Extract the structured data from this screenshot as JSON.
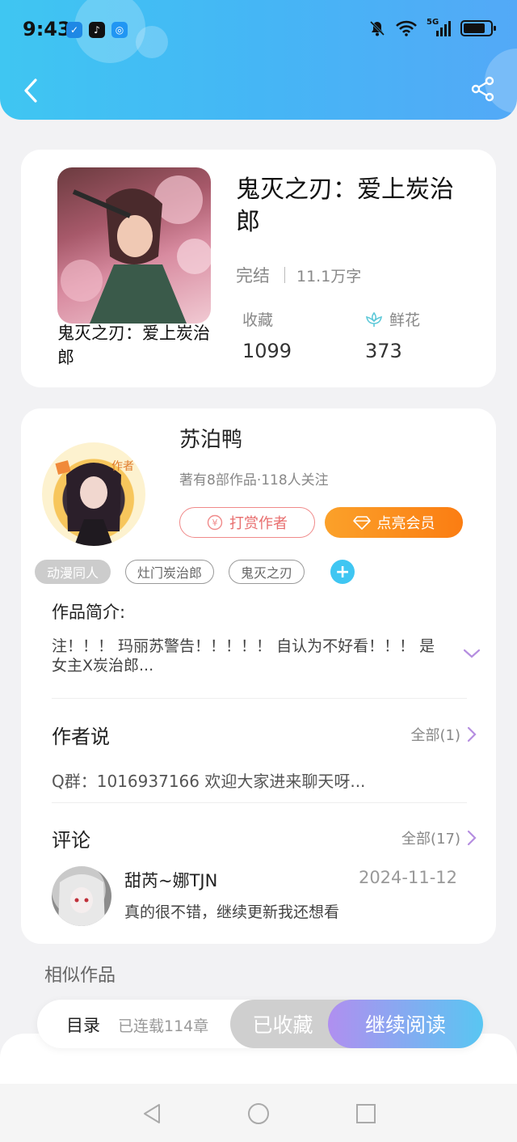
{
  "status_bar": {
    "time": "9:43",
    "network": "5G"
  },
  "header": {
    "back_icon": "chevron-left-icon",
    "share_icon": "share-icon"
  },
  "book": {
    "cover_title": "鬼灭之刃：爱上炭治郎",
    "title": "鬼灭之刃：爱上炭治郎",
    "status": "完结",
    "word_count": "11.1万字",
    "favorites_label": "收藏",
    "favorites_value": "1099",
    "flowers_label": "鲜花",
    "flowers_value": "373"
  },
  "author": {
    "badge": "作者",
    "name": "苏泊鸭",
    "meta": "著有8部作品·118人关注",
    "tip_label": "打赏作者",
    "vip_label": "点亮会员"
  },
  "tags": [
    "动漫同人",
    "灶门炭治郎",
    "鬼灭之刃"
  ],
  "intro": {
    "label": "作品简介:",
    "text": "注！！！ 玛丽苏警告！！！！！ 自认为不好看！！！ 是女主X炭治郎..."
  },
  "author_says": {
    "title": "作者说",
    "more": "全部(1)",
    "text": "Q群：1016937166 欢迎大家进来聊天呀..."
  },
  "comments": {
    "title": "评论",
    "more": "全部(17)",
    "items": [
      {
        "name": "甜芮~娜TJN",
        "date": "2024-11-12",
        "text": "真的很不错，继续更新我还想看"
      }
    ]
  },
  "similar": {
    "label": "相似作品"
  },
  "bottom_bar": {
    "toc_label": "目录",
    "toc_count": "已连载114章",
    "favorite_button": "已收藏",
    "read_button": "继续阅读"
  },
  "colors": {
    "header_start": "#3fc6f2",
    "header_end": "#53a9f7",
    "vip_orange": "#fb8d1a",
    "tip_red": "#e86f6f",
    "accent_purple": "#b08ff0"
  }
}
